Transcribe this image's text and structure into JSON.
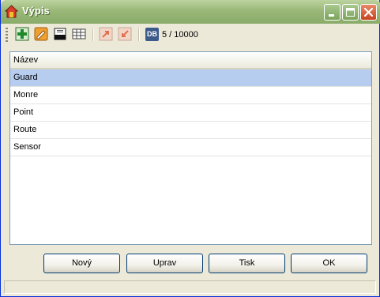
{
  "window": {
    "title": "Výpis"
  },
  "title_buttons": [
    "minimize",
    "maximize",
    "close"
  ],
  "toolbar": {
    "tools": [
      "add-icon",
      "edit-icon",
      "print-preview-icon",
      "table-icon",
      "export-icon",
      "import-icon"
    ],
    "db_badge": "DB",
    "record_count": "5 / 10000"
  },
  "list": {
    "header": "Název",
    "rows": [
      {
        "label": "Guard",
        "selected": true
      },
      {
        "label": "Monre",
        "selected": false
      },
      {
        "label": "Point",
        "selected": false
      },
      {
        "label": "Route",
        "selected": false
      },
      {
        "label": "Sensor",
        "selected": false
      }
    ]
  },
  "buttons": {
    "new_label": "Nový",
    "edit_label": "Uprav",
    "print_label": "Tisk",
    "ok_label": "OK"
  },
  "colors": {
    "titlebar": "#9ab878",
    "selection": "#b6cdf0",
    "face": "#ece9d8"
  }
}
